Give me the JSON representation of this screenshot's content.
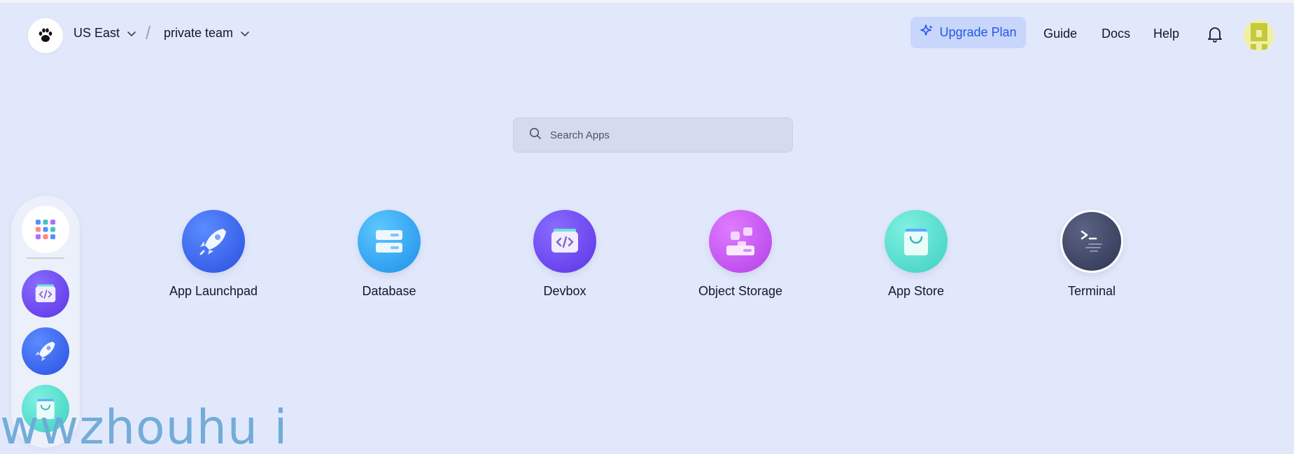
{
  "header": {
    "region_label": "US East",
    "team_label": "private team",
    "separator": "/",
    "upgrade_label": "Upgrade Plan",
    "nav": [
      "Guide",
      "Docs",
      "Help"
    ]
  },
  "search": {
    "placeholder": "Search Apps"
  },
  "apps": [
    {
      "label": "App Launchpad",
      "icon": "rocket-icon"
    },
    {
      "label": "Database",
      "icon": "database-icon"
    },
    {
      "label": "Devbox",
      "icon": "devbox-icon"
    },
    {
      "label": "Object Storage",
      "icon": "object-storage-icon"
    },
    {
      "label": "App Store",
      "icon": "shopping-bag-icon"
    },
    {
      "label": "Terminal",
      "icon": "terminal-icon"
    }
  ],
  "dock": [
    "apps-grid-icon",
    "devbox-icon",
    "rocket-icon",
    "shopping-bag-icon"
  ],
  "watermark": "wwzhouhu i",
  "colors": {
    "background": "#e2e8fb",
    "accent": "#2457e6",
    "upgrade_bg": "#c8d6fb"
  }
}
